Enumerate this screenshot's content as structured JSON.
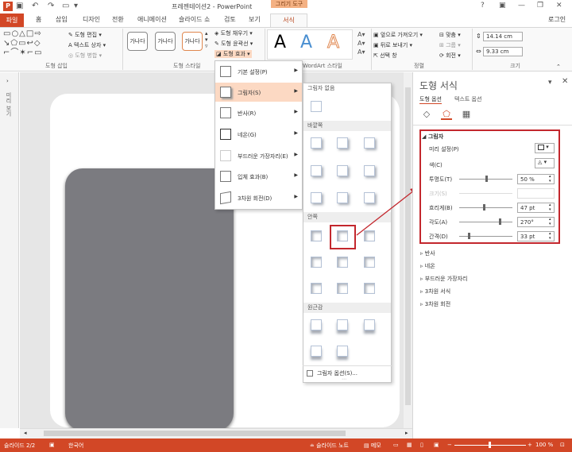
{
  "app": {
    "title": "프레젠테이션2 - PowerPoint",
    "context_tool": "그리기 도구"
  },
  "tabs": [
    "파일",
    "홈",
    "삽입",
    "디자인",
    "전환",
    "애니메이션",
    "슬라이드 쇼",
    "검토",
    "보기",
    "서식"
  ],
  "signin": "로그인",
  "ribbon": {
    "insert_shapes": {
      "edit_shape": "도형 편집",
      "textbox": "텍스트 상자",
      "merge": "도형 병합",
      "label": "도형 삽입"
    },
    "shape_styles": {
      "swatch": "가나다",
      "fill": "도형 채우기",
      "outline": "도형 윤곽선",
      "effects": "도형 효과",
      "label": "도형 스타일"
    },
    "wordart": {
      "letter": "A",
      "label": "WordArt 스타일"
    },
    "arrange": {
      "bring_forward": "앞으로 가져오기",
      "send_backward": "뒤로 보내기",
      "selection": "선택 창",
      "align": "맞춤",
      "group": "그룹",
      "rotate": "회전",
      "label": "정렬"
    },
    "size": {
      "height": "14.14 cm",
      "width": "9.33 cm",
      "label": "크기"
    }
  },
  "slide_strip_label": "미리 보기",
  "effects_menu": [
    {
      "label": "기본 설정(P)"
    },
    {
      "label": "그림자(S)"
    },
    {
      "label": "반사(R)"
    },
    {
      "label": "네온(G)"
    },
    {
      "label": "부드러운 가장자리(E)"
    },
    {
      "label": "입체 효과(B)"
    },
    {
      "label": "3차원 회전(D)"
    }
  ],
  "shadow_gallery": {
    "none_header": "그림자 없음",
    "outer_header": "바깥쪽",
    "inner_header": "안쪽",
    "perspective_header": "원근감",
    "options": "그림자 옵션(S)..."
  },
  "format_pane": {
    "title": "도형 서식",
    "tab_shape": "도형 옵션",
    "tab_text": "텍스트 옵션",
    "section_shadow": "그림자",
    "preset": "미리 설정(P)",
    "color": "색(C)",
    "transparency": {
      "label": "투명도(T)",
      "value": "50 %",
      "level": 0.5
    },
    "size": {
      "label": "크기(S)",
      "value": ""
    },
    "blur": {
      "label": "흐리게(B)",
      "value": "47 pt"
    },
    "angle": {
      "label": "각도(A)",
      "value": "270°"
    },
    "distance": {
      "label": "간격(D)",
      "value": "33 pt"
    },
    "sections": [
      "반사",
      "네온",
      "부드러운 가장자리",
      "3차원 서식",
      "3차원 회전"
    ]
  },
  "status": {
    "slide": "슬라이드 2/2",
    "lang": "한국어",
    "notes": "슬라이드 노트",
    "comments": "메모",
    "zoom": "100 %"
  },
  "colors": {
    "accent": "#d24726",
    "highlight": "#c3272d",
    "menu_hover": "#fcd9c3"
  }
}
